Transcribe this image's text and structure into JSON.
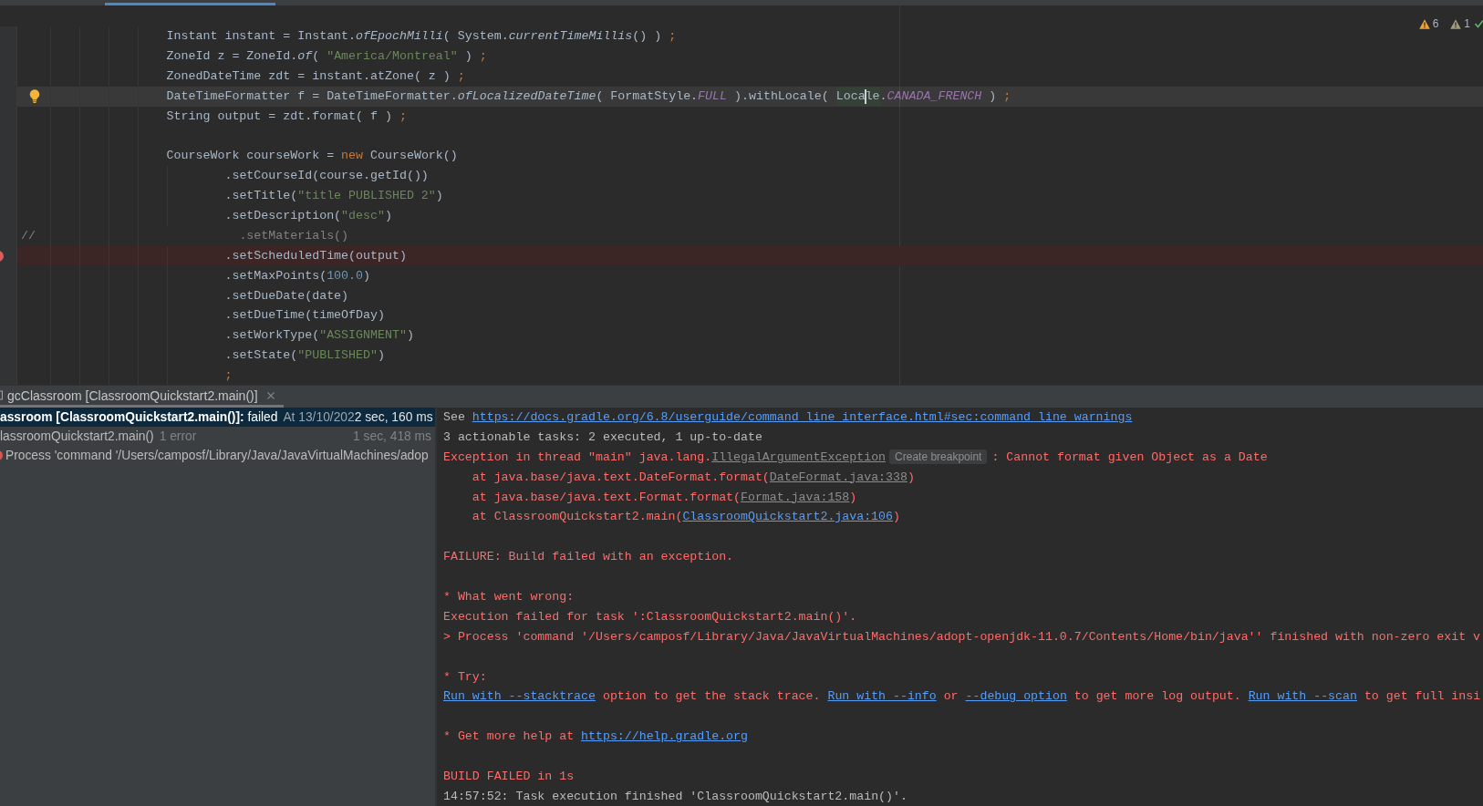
{
  "editor": {
    "inspections": [
      {
        "kind": "warning",
        "count": "6"
      },
      {
        "kind": "weak_warning",
        "count": "1"
      }
    ],
    "lines": [
      {
        "current": false,
        "breakpoint": false,
        "intention_bulb": false,
        "tokens": [
          {
            "kind": "plain",
            "text": "                    Instant instant = Instant."
          },
          {
            "kind": "method",
            "text": "ofEpochMilli"
          },
          {
            "kind": "plain",
            "text": "( System."
          },
          {
            "kind": "method",
            "text": "currentTimeMillis"
          },
          {
            "kind": "plain",
            "text": "() ) "
          },
          {
            "kind": "keyword",
            "text": ";"
          }
        ]
      },
      {
        "current": false,
        "breakpoint": false,
        "intention_bulb": false,
        "tokens": [
          {
            "kind": "plain",
            "text": "                    ZoneId z = ZoneId."
          },
          {
            "kind": "method",
            "text": "of"
          },
          {
            "kind": "plain",
            "text": "( "
          },
          {
            "kind": "string",
            "text": "\"America/Montreal\""
          },
          {
            "kind": "plain",
            "text": " ) "
          },
          {
            "kind": "keyword",
            "text": ";"
          }
        ]
      },
      {
        "current": false,
        "breakpoint": false,
        "intention_bulb": false,
        "tokens": [
          {
            "kind": "plain",
            "text": "                    ZonedDateTime zdt = instant.atZone( z ) "
          },
          {
            "kind": "keyword",
            "text": ";"
          }
        ]
      },
      {
        "current": true,
        "breakpoint": false,
        "intention_bulb": true,
        "tokens": [
          {
            "kind": "plain",
            "text": "                    DateTimeFormatter f = DateTimeFormatter."
          },
          {
            "kind": "method",
            "text": "ofLocalizedDateTime"
          },
          {
            "kind": "plain",
            "text": "( FormatStyle."
          },
          {
            "kind": "constant",
            "text": "FULL"
          },
          {
            "kind": "plain",
            "text": " ).withLocale( "
          },
          {
            "kind": "usage",
            "text": "Loca"
          },
          {
            "kind": "caret"
          },
          {
            "kind": "usage",
            "text": "le"
          },
          {
            "kind": "plain",
            "text": "."
          },
          {
            "kind": "constant",
            "text": "CANADA_FRENCH"
          },
          {
            "kind": "plain",
            "text": " ) "
          },
          {
            "kind": "keyword",
            "text": ";"
          }
        ]
      },
      {
        "current": false,
        "breakpoint": false,
        "intention_bulb": false,
        "tokens": [
          {
            "kind": "plain",
            "text": "                    String output = zdt.format( f ) "
          },
          {
            "kind": "keyword",
            "text": ";"
          }
        ]
      },
      {
        "current": false,
        "breakpoint": false,
        "intention_bulb": false
      },
      {
        "current": false,
        "breakpoint": false,
        "intention_bulb": false,
        "tokens": [
          {
            "kind": "plain",
            "text": "                    CourseWork courseWork = "
          },
          {
            "kind": "keyword",
            "text": "new"
          },
          {
            "kind": "plain",
            "text": " CourseWork()"
          }
        ]
      },
      {
        "current": false,
        "breakpoint": false,
        "intention_bulb": false,
        "tokens": [
          {
            "kind": "plain",
            "text": "                            .setCourseId(course.getId())"
          }
        ]
      },
      {
        "current": false,
        "breakpoint": false,
        "intention_bulb": false,
        "tokens": [
          {
            "kind": "plain",
            "text": "                            .setTitle("
          },
          {
            "kind": "string",
            "text": "\"title PUBLISHED 2\""
          },
          {
            "kind": "plain",
            "text": ")"
          }
        ]
      },
      {
        "current": false,
        "breakpoint": false,
        "intention_bulb": false,
        "tokens": [
          {
            "kind": "plain",
            "text": "                            .setDescription("
          },
          {
            "kind": "string",
            "text": "\"desc\""
          },
          {
            "kind": "plain",
            "text": ")"
          }
        ]
      },
      {
        "current": false,
        "breakpoint": false,
        "intention_bulb": false,
        "tokens": [
          {
            "kind": "comment",
            "text": "//                            .setMaterials()"
          }
        ]
      },
      {
        "current": false,
        "breakpoint": true,
        "intention_bulb": false,
        "tokens": [
          {
            "kind": "plain",
            "text": "                            .setScheduledTime(output)"
          }
        ]
      },
      {
        "current": false,
        "breakpoint": false,
        "intention_bulb": false,
        "tokens": [
          {
            "kind": "plain",
            "text": "                            .setMaxPoints("
          },
          {
            "kind": "number",
            "text": "100.0"
          },
          {
            "kind": "plain",
            "text": ")"
          }
        ]
      },
      {
        "current": false,
        "breakpoint": false,
        "intention_bulb": false,
        "tokens": [
          {
            "kind": "plain",
            "text": "                            .setDueDate(date)"
          }
        ]
      },
      {
        "current": false,
        "breakpoint": false,
        "intention_bulb": false,
        "tokens": [
          {
            "kind": "plain",
            "text": "                            .setDueTime(timeOfDay)"
          }
        ]
      },
      {
        "current": false,
        "breakpoint": false,
        "intention_bulb": false,
        "tokens": [
          {
            "kind": "plain",
            "text": "                            .setWorkType("
          },
          {
            "kind": "string",
            "text": "\"ASSIGNMENT\""
          },
          {
            "kind": "plain",
            "text": ")"
          }
        ]
      },
      {
        "current": false,
        "breakpoint": false,
        "intention_bulb": false,
        "tokens": [
          {
            "kind": "plain",
            "text": "                            .setState("
          },
          {
            "kind": "string",
            "text": "\"PUBLISHED\""
          },
          {
            "kind": "plain",
            "text": ")"
          }
        ]
      },
      {
        "current": false,
        "breakpoint": false,
        "intention_bulb": false,
        "tokens": [
          {
            "kind": "keyword",
            "text": "                            ;"
          }
        ]
      }
    ]
  },
  "run_panel": {
    "tabs": [
      {
        "label": "gcClassroom [ClassroomQuickstart2.main()]",
        "selected": true,
        "closable": true
      }
    ],
    "build_tree": {
      "rows": [
        {
          "kind": "task",
          "title": "**assroom [ClassroomQuickstart2.main()]:** failed",
          "detail": "At 13/10/202",
          "duration": "2 sec, 160 ms",
          "selected": true
        },
        {
          "kind": "task",
          "title": "lassroomQuickstart2.main()",
          "detail": "1 error",
          "duration": "1 sec, 418 ms",
          "selected": false
        },
        {
          "kind": "error",
          "title": "Process 'command '/Users/camposf/Library/Java/JavaVirtualMachines/adop",
          "selected": false
        }
      ]
    },
    "console": {
      "blocks": [
        {
          "lines": [
            {
              "kind": "output",
              "segments": [
                {
                  "kind": "text",
                  "text": "See "
                },
                {
                  "kind": "link",
                  "text": "https://docs.gradle.org/6.8/userguide/command_line_interface.html#sec:command_line_warnings"
                }
              ]
            },
            {
              "kind": "output",
              "segments": [
                {
                  "kind": "text",
                  "text": "3 actionable tasks: 2 executed, 1 up-to-date"
                }
              ]
            },
            {
              "kind": "error",
              "segments": [
                {
                  "kind": "text",
                  "text": "Exception in thread \"main\" java.lang."
                },
                {
                  "kind": "source_link",
                  "text": "IllegalArgumentException"
                },
                {
                  "kind": "hint_button",
                  "text": "Create breakpoint"
                },
                {
                  "kind": "text",
                  "text": ": Cannot format given Object as a Date"
                }
              ]
            },
            {
              "kind": "error",
              "segments": [
                {
                  "kind": "text",
                  "text": "    at java.base/java.text.DateFormat.format("
                },
                {
                  "kind": "source_link",
                  "text": "DateFormat.java:338"
                },
                {
                  "kind": "text",
                  "text": ")"
                }
              ]
            },
            {
              "kind": "error",
              "segments": [
                {
                  "kind": "text",
                  "text": "    at java.base/java.text.Format.format("
                },
                {
                  "kind": "source_link",
                  "text": "Format.java:158"
                },
                {
                  "kind": "text",
                  "text": ")"
                }
              ]
            },
            {
              "kind": "error",
              "segments": [
                {
                  "kind": "text",
                  "text": "    at ClassroomQuickstart2.main("
                },
                {
                  "kind": "link",
                  "text": "ClassroomQuickstart2.java:106"
                },
                {
                  "kind": "text",
                  "text": ")"
                }
              ]
            }
          ]
        },
        {
          "lines": [
            {
              "kind": "error",
              "segments": [
                {
                  "kind": "text",
                  "text": "FAILURE: Build failed with an exception."
                }
              ]
            }
          ]
        },
        {
          "lines": [
            {
              "kind": "error",
              "segments": [
                {
                  "kind": "text",
                  "text": "* What went wrong:"
                }
              ]
            },
            {
              "kind": "error",
              "segments": [
                {
                  "kind": "text",
                  "text": "Execution failed for task ':ClassroomQuickstart2.main()'."
                }
              ]
            },
            {
              "kind": "error",
              "segments": [
                {
                  "kind": "text",
                  "text": "> Process 'command '/Users/camposf/Library/Java/JavaVirtualMachines/adopt-openjdk-11.0.7/Contents/Home/bin/java'' finished with non-zero exit v"
                }
              ]
            }
          ]
        },
        {
          "lines": [
            {
              "kind": "error",
              "segments": [
                {
                  "kind": "text",
                  "text": "* Try:"
                }
              ]
            },
            {
              "kind": "error",
              "segments": [
                {
                  "kind": "link",
                  "text": "Run with --stacktrace"
                },
                {
                  "kind": "text",
                  "text": " option to get the stack trace. "
                },
                {
                  "kind": "link",
                  "text": "Run with --info"
                },
                {
                  "kind": "text",
                  "text": " or "
                },
                {
                  "kind": "link",
                  "text": "--debug option"
                },
                {
                  "kind": "text",
                  "text": " to get more log output. "
                },
                {
                  "kind": "link",
                  "text": "Run with --scan"
                },
                {
                  "kind": "text",
                  "text": " to get full insi"
                }
              ]
            }
          ]
        },
        {
          "lines": [
            {
              "kind": "error",
              "segments": [
                {
                  "kind": "text",
                  "text": "* Get more help at "
                },
                {
                  "kind": "link",
                  "text": "https://help.gradle.org"
                }
              ]
            }
          ]
        },
        {
          "lines": [
            {
              "kind": "error",
              "segments": [
                {
                  "kind": "text",
                  "text": "BUILD FAILED in 1s"
                }
              ]
            },
            {
              "kind": "output",
              "segments": [
                {
                  "kind": "text",
                  "text": "14:57:52: Task execution finished 'ClassroomQuickstart2.main()'."
                }
              ]
            }
          ]
        }
      ]
    }
  }
}
